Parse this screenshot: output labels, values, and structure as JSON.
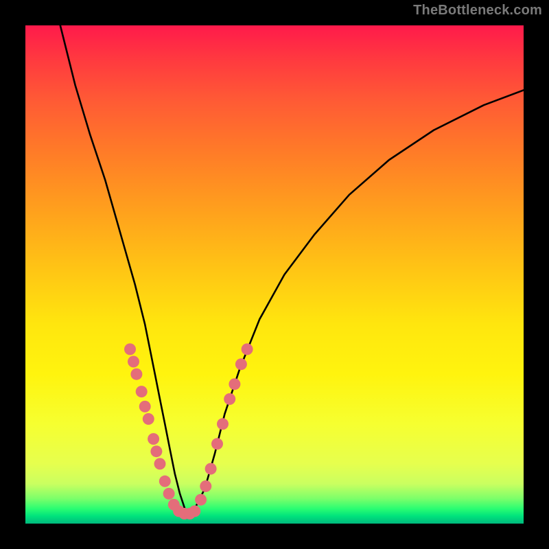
{
  "watermark": "TheBottleneck.com",
  "chart_data": {
    "type": "line",
    "title": "",
    "xlabel": "",
    "ylabel": "",
    "xlim": [
      0,
      100
    ],
    "ylim": [
      0,
      100
    ],
    "grid": false,
    "legend": false,
    "series": [
      {
        "name": "curve",
        "x": [
          7,
          10,
          13,
          16,
          18,
          20,
          22,
          24,
          25,
          26,
          27,
          28,
          29,
          30,
          31,
          32,
          33,
          34,
          36,
          38,
          40,
          43,
          47,
          52,
          58,
          65,
          73,
          82,
          92,
          100
        ],
        "y": [
          100,
          88,
          78,
          69,
          62,
          55,
          48,
          40,
          35,
          30,
          25,
          20,
          15,
          10,
          6,
          3,
          2,
          3,
          7,
          14,
          22,
          31,
          41,
          50,
          58,
          66,
          73,
          79,
          84,
          87
        ]
      }
    ],
    "markers": {
      "left": [
        {
          "x": 21.0,
          "y": 35.0
        },
        {
          "x": 21.7,
          "y": 32.5
        },
        {
          "x": 22.3,
          "y": 30.0
        },
        {
          "x": 23.3,
          "y": 26.5
        },
        {
          "x": 24.0,
          "y": 23.5
        },
        {
          "x": 24.7,
          "y": 21.0
        },
        {
          "x": 25.7,
          "y": 17.0
        },
        {
          "x": 26.3,
          "y": 14.5
        },
        {
          "x": 27.0,
          "y": 12.0
        },
        {
          "x": 28.0,
          "y": 8.5
        },
        {
          "x": 28.8,
          "y": 6.0
        },
        {
          "x": 29.8,
          "y": 3.8
        },
        {
          "x": 30.8,
          "y": 2.5
        },
        {
          "x": 31.9,
          "y": 2.0
        }
      ],
      "right": [
        {
          "x": 33.0,
          "y": 2.0
        },
        {
          "x": 34.0,
          "y": 2.5
        },
        {
          "x": 35.2,
          "y": 4.8
        },
        {
          "x": 36.2,
          "y": 7.5
        },
        {
          "x": 37.2,
          "y": 11.0
        },
        {
          "x": 38.5,
          "y": 16.0
        },
        {
          "x": 39.6,
          "y": 20.0
        },
        {
          "x": 41.0,
          "y": 25.0
        },
        {
          "x": 42.0,
          "y": 28.0
        },
        {
          "x": 43.3,
          "y": 32.0
        },
        {
          "x": 44.5,
          "y": 35.0
        }
      ]
    },
    "gradient_colors": {
      "top": "#ff1a4b",
      "mid": "#ffe60e",
      "bottom": "#00b97d"
    }
  }
}
